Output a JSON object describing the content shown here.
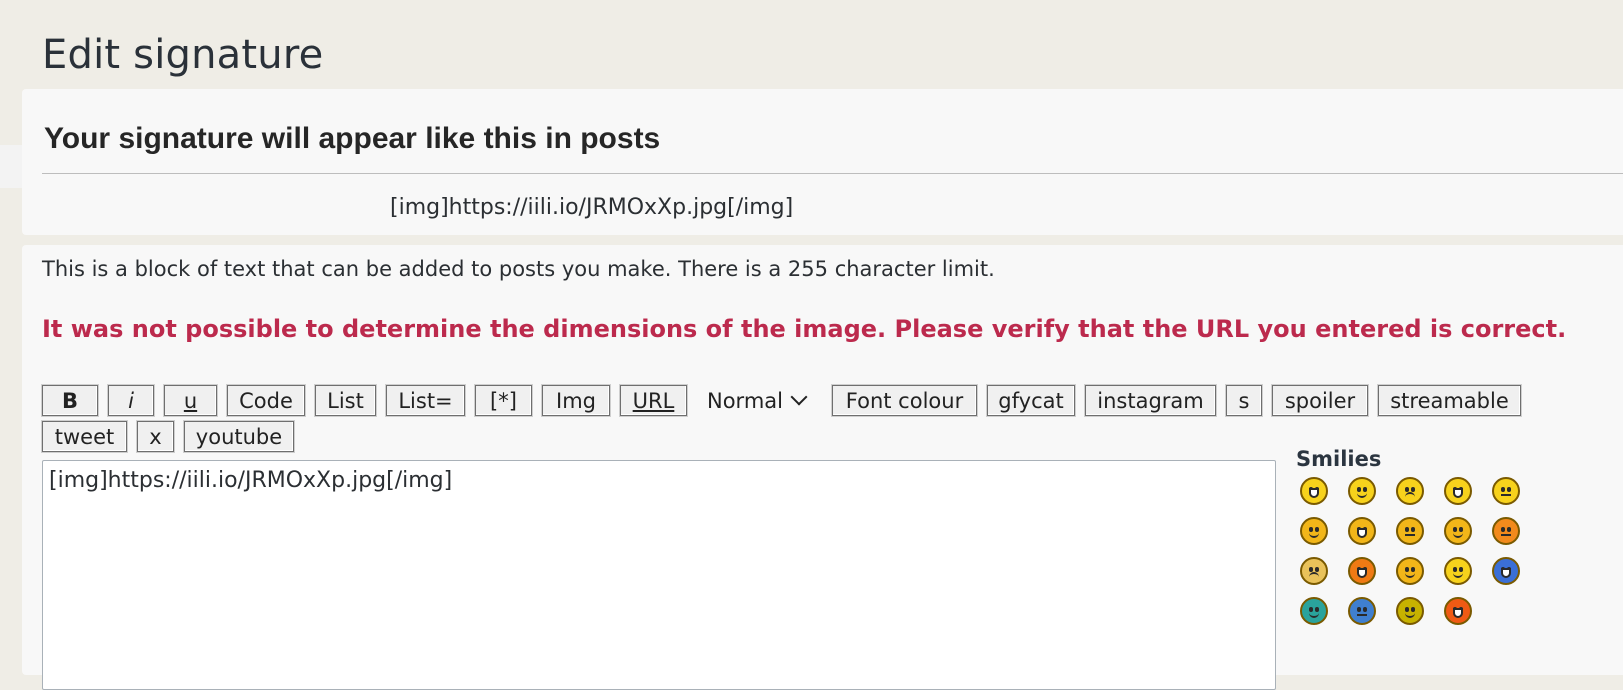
{
  "page": {
    "title": "Edit signature"
  },
  "preview": {
    "heading": "Your signature will appear like this in posts",
    "content": "[img]https://iili.io/JRMOxXp.jpg[/img]"
  },
  "form": {
    "explain": "This is a block of text that can be added to posts you make. There is a 255 character limit.",
    "error": "It was not possible to determine the dimensions of the image. Please verify that the URL you entered is correct.",
    "toolbar": {
      "bold": "B",
      "italic": "i",
      "underline": "u",
      "code": "Code",
      "list": "List",
      "list_ordered": "List=",
      "list_item": "[*]",
      "img": "Img",
      "url": "URL",
      "font_size": "Normal",
      "font_colour": "Font colour",
      "gfycat": "gfycat",
      "instagram": "instagram",
      "s": "s",
      "spoiler": "spoiler",
      "streamable": "streamable",
      "tweet": "tweet",
      "x": "x",
      "youtube": "youtube"
    },
    "signature_value": "[img]https://iili.io/JRMOxXp.jpg[/img]"
  },
  "smilies": {
    "title": "Smilies",
    "icons": [
      {
        "name": "very-happy-smiley-icon",
        "color": "#f7d21c",
        "mouth": "open"
      },
      {
        "name": "smile-smiley-icon",
        "color": "#f7d21c",
        "mouth": "smile"
      },
      {
        "name": "sad-smiley-icon",
        "color": "#f7d21c",
        "mouth": "sad"
      },
      {
        "name": "surprised-smiley-icon",
        "color": "#f7d21c",
        "mouth": "open"
      },
      {
        "name": "confused-smiley-icon",
        "color": "#f7d21c",
        "mouth": "flat"
      },
      {
        "name": "cool-smiley-icon",
        "color": "#f2b619",
        "mouth": "smile"
      },
      {
        "name": "laughing-smiley-icon",
        "color": "#f2b619",
        "mouth": "open"
      },
      {
        "name": "mad-smiley-icon",
        "color": "#f2b619",
        "mouth": "flat"
      },
      {
        "name": "razz-smiley-icon",
        "color": "#f2b619",
        "mouth": "smile"
      },
      {
        "name": "embarrassed-smiley-icon",
        "color": "#f28a1c",
        "mouth": "flat"
      },
      {
        "name": "crying-smiley-icon",
        "color": "#e9c25a",
        "mouth": "sad"
      },
      {
        "name": "evil-smiley-icon",
        "color": "#f07a14",
        "mouth": "open"
      },
      {
        "name": "twisted-evil-smiley-icon",
        "color": "#f2b619",
        "mouth": "smile"
      },
      {
        "name": "wink-smiley-icon",
        "color": "#f7d21c",
        "mouth": "smile"
      },
      {
        "name": "rolling-eyes-smiley-icon",
        "color": "#3b6fd6",
        "mouth": "open"
      },
      {
        "name": "mr-green-smiley-icon",
        "color": "#2aa39c",
        "mouth": "smile"
      },
      {
        "name": "blue-smiley-icon",
        "color": "#3f7fd0",
        "mouth": "flat"
      },
      {
        "name": "neutral-smiley-icon",
        "color": "#c7b200",
        "mouth": "smile"
      },
      {
        "name": "exclamation-smiley-icon",
        "color": "#f05a14",
        "mouth": "open"
      }
    ]
  }
}
